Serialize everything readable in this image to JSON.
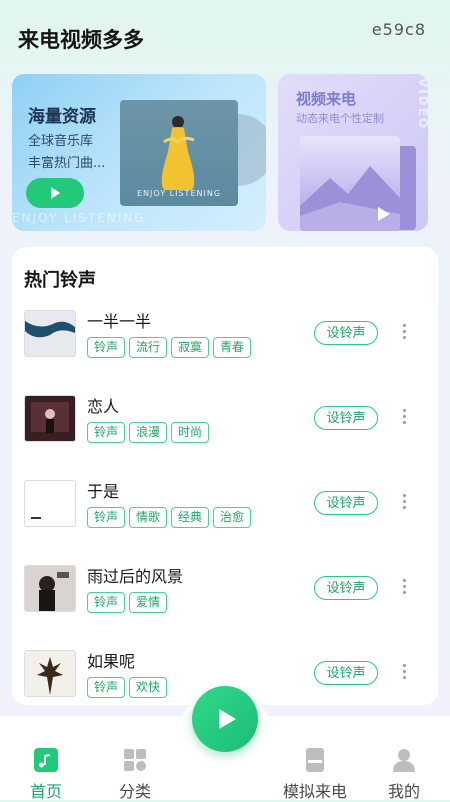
{
  "header": {
    "title": "来电视频多多",
    "code": "e59c8"
  },
  "banner_main": {
    "title": "海量资源",
    "line1": "全球音乐库",
    "line2": "丰富热门曲...",
    "album_caption": "ENJOY LISTENING",
    "watermark": "ENJOY LISTENING"
  },
  "banner_video": {
    "title": "视频来电",
    "subtitle": "动态来电个性定制",
    "vertical_text": "VIDEO"
  },
  "ringtones": {
    "title": "热门铃声",
    "set_label": "设铃声",
    "items": [
      {
        "name": "一半一半",
        "tags": [
          "铃声",
          "流行",
          "寂寞",
          "青春"
        ]
      },
      {
        "name": "恋人",
        "tags": [
          "铃声",
          "浪漫",
          "时尚"
        ]
      },
      {
        "name": "于是",
        "tags": [
          "铃声",
          "情歌",
          "经典",
          "治愈"
        ]
      },
      {
        "name": "雨过后的风景",
        "tags": [
          "铃声",
          "爱情"
        ]
      },
      {
        "name": "如果呢",
        "tags": [
          "铃声",
          "欢快"
        ]
      }
    ]
  },
  "tabbar": {
    "home": "首页",
    "category": "分类",
    "simulate": "模拟来电",
    "mine": "我的"
  },
  "colors": {
    "accent": "#23c97a",
    "tag_green": "#1fa866"
  }
}
